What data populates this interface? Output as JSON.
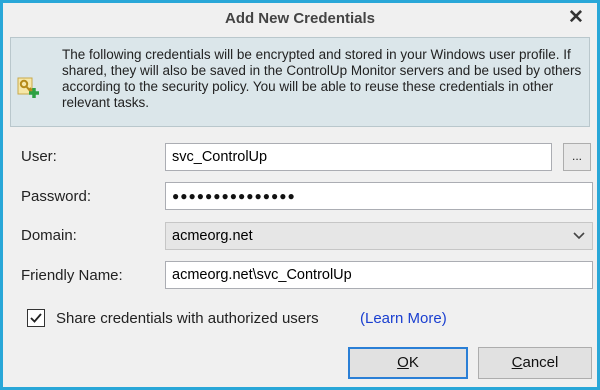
{
  "dialog": {
    "title": "Add New Credentials",
    "close_label": "✕"
  },
  "info": {
    "icon": "key-add-icon",
    "text": "The following credentials will be encrypted and stored in your Windows user profile. If shared, they will also be saved in the ControlUp Monitor servers and be used by others according to the security policy. You will be able to reuse these credentials in other relevant tasks."
  },
  "form": {
    "user_label": "User:",
    "user_value": "svc_ControlUp",
    "browse_label": "...",
    "password_label": "Password:",
    "password_mask": "●●●●●●●●●●●●●●●",
    "domain_label": "Domain:",
    "domain_value": "acmeorg.net",
    "friendly_label": "Friendly Name:",
    "friendly_value": "acmeorg.net\\svc_ControlUp"
  },
  "share": {
    "checked": true,
    "label": "Share credentials with authorized users",
    "learn_more": "(Learn More)"
  },
  "buttons": {
    "ok_underline": "O",
    "ok_rest": "K",
    "cancel_underline": "C",
    "cancel_rest": "ancel"
  },
  "colors": {
    "accent": "#29a7d8",
    "link": "#1a3fd0",
    "default_button_border": "#2a7fd6"
  }
}
